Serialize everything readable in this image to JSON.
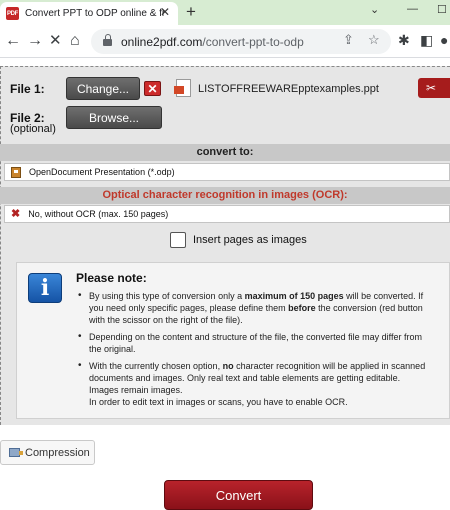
{
  "browser": {
    "tab_title": "Convert PPT to ODP online & fre",
    "tab_favicon_text": "PDF",
    "url_domain": "online2pdf.com",
    "url_path": "/convert-ppt-to-odp",
    "window_controls": [
      "⌄",
      "—",
      "☐"
    ]
  },
  "upload": {
    "file1_label": "File 1:",
    "change_button": "Change...",
    "file_name": "LISTOFFREEWAREpptexamples.ppt",
    "file2_label": "File 2:",
    "file2_sub": "(optional)",
    "browse_button": "Browse..."
  },
  "convert_to": {
    "header": "convert to:",
    "selected": "OpenDocument Presentation (*.odp)"
  },
  "ocr": {
    "header": "Optical character recognition in images (OCR):",
    "header_color": "#c0392b",
    "selected": "No, without OCR (max. 150 pages)"
  },
  "insert_pages": {
    "label": "Insert pages as images",
    "checked": false
  },
  "note": {
    "title": "Please note:",
    "item1": {
      "a": "By using this type of conversion only a ",
      "b": "maximum of 150 pages",
      "c": " will be converted. If you need only specific pages, please define them ",
      "d": "before",
      "e": " the conversion (red button with the scissor on the right of the file)."
    },
    "item2": "Depending on the content and structure of the file, the converted file may differ from the original.",
    "item3": {
      "a": "With the currently chosen option, ",
      "b": "no",
      "c": " character recognition will be applied in scanned documents and images. Only real text and table elements are getting editable. Images remain images.",
      "d": "In order to edit text in images or scans, you have to enable OCR."
    }
  },
  "compression_button": "Compression",
  "convert_button": "Convert",
  "colors": {
    "tabbar": "#d7ecd2",
    "convert_red": "#a61c1c",
    "panel_gray": "#e6e6e6"
  }
}
